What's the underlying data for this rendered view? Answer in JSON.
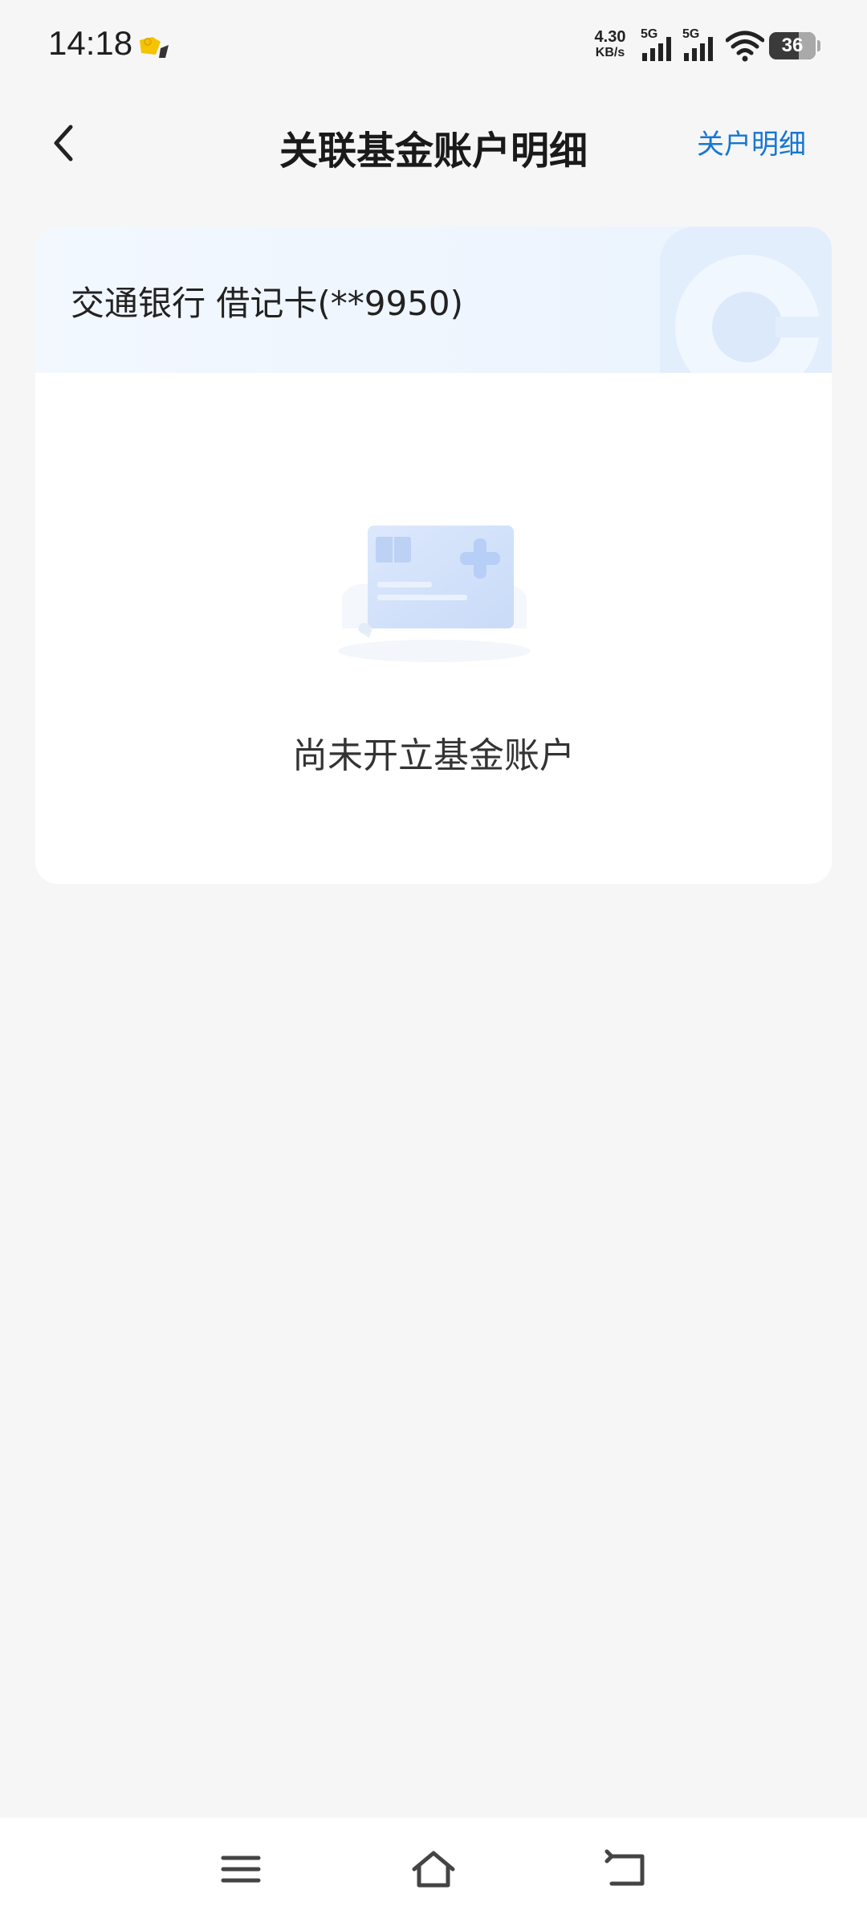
{
  "status_bar": {
    "time": "14:18",
    "net_speed_value": "4.30",
    "net_speed_unit": "KB/s",
    "sim1_label": "5G",
    "sim2_label": "5G",
    "battery_level": "36",
    "app_icon": "notification-app-icon",
    "wifi_icon": "wifi-icon"
  },
  "header": {
    "back_icon": "chevron-left-icon",
    "title": "关联基金账户明细",
    "right_link": "关户明细"
  },
  "card": {
    "bank_name": "交通银行 借记卡(**9950)",
    "empty_illustration": "card-add-illustration",
    "empty_text": "尚未开立基金账户"
  },
  "nav_bar": {
    "menu_icon": "menu-icon",
    "home_icon": "home-icon",
    "back_icon": "back-arrow-icon"
  },
  "colors": {
    "accent": "#1677d2",
    "background": "#f6f6f6",
    "card_header": "#eef5fe"
  }
}
